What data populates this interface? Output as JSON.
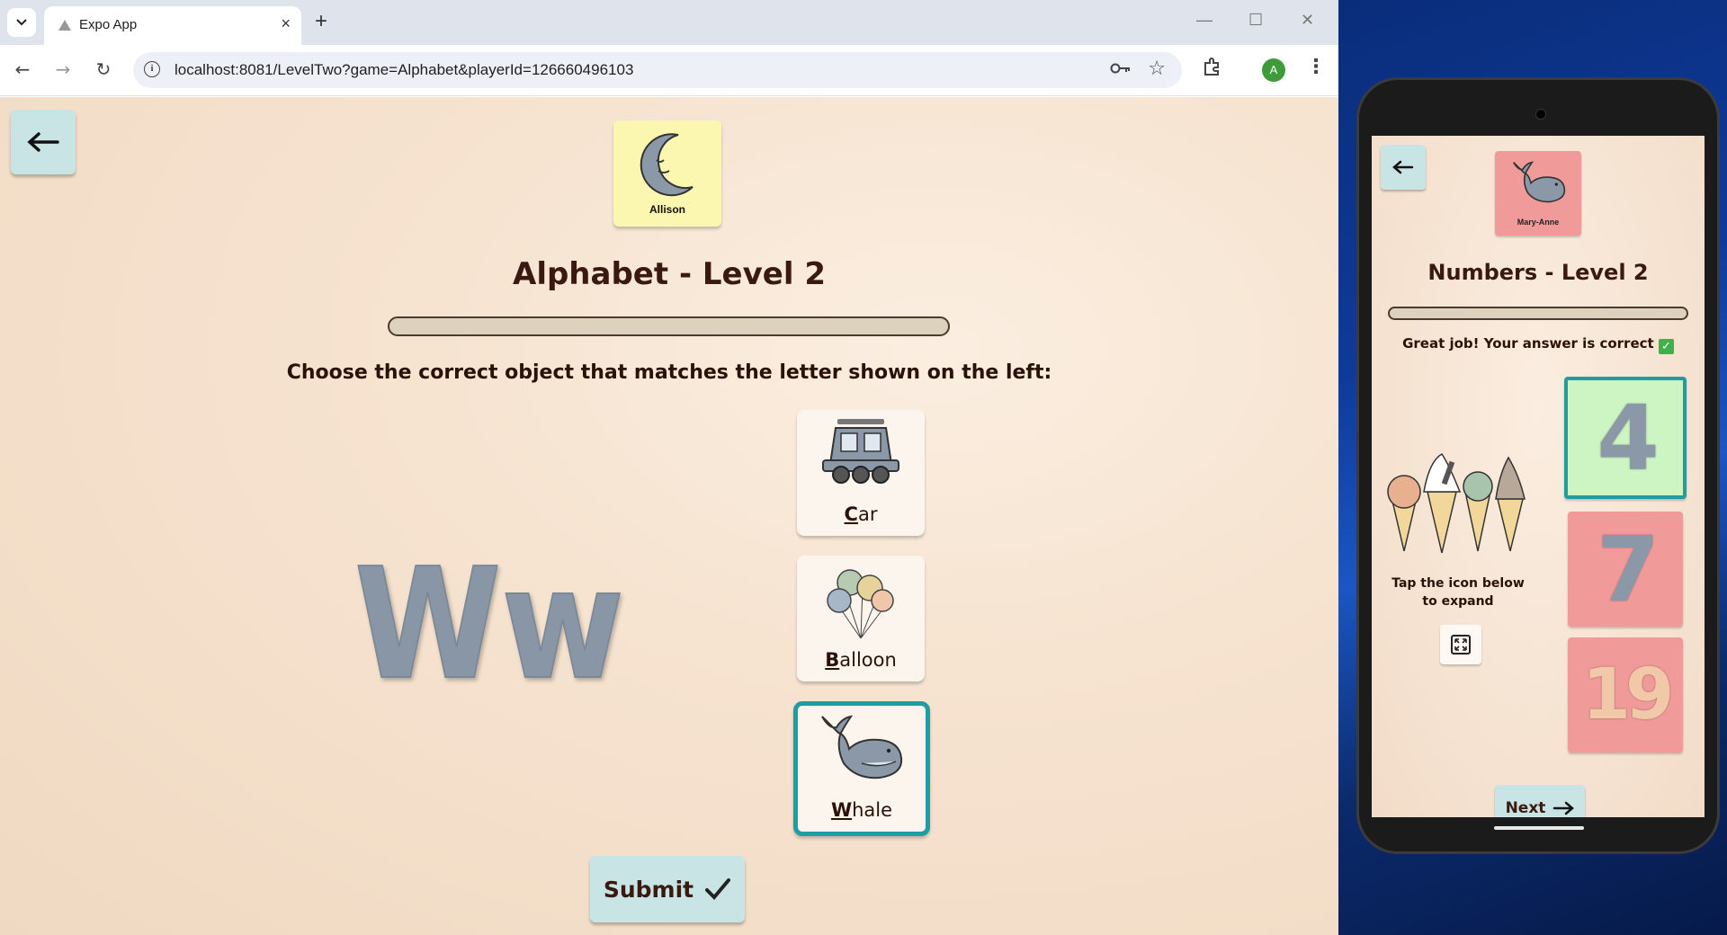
{
  "browser": {
    "tab_title": "Expo App",
    "tab_close": "×",
    "new_tab": "+",
    "url": "localhost:8081/LevelTwo?game=Alphabet&playerId=126660496103",
    "profile_initial": "A",
    "window_controls": [
      "—",
      "☐",
      "✕"
    ]
  },
  "game": {
    "player_name": "Allison",
    "avatar_icon": "moon-icon",
    "title": "Alphabet - Level 2",
    "progress": 0,
    "instructions": "Choose the correct object that matches the letter shown on the left:",
    "letter": "Ww",
    "options": [
      {
        "first": "C",
        "rest": "ar",
        "icon": "car-icon",
        "selected": false
      },
      {
        "first": "B",
        "rest": "alloon",
        "icon": "balloon-icon",
        "selected": false
      },
      {
        "first": "W",
        "rest": "hale",
        "icon": "whale-icon",
        "selected": true
      }
    ],
    "submit_label": "Submit"
  },
  "phone": {
    "player_name": "Mary-Anne",
    "avatar_icon": "whale-icon",
    "title": "Numbers - Level 2",
    "progress": 0,
    "feedback": "Great job! Your answer is correct",
    "feedback_icon": "✓",
    "tap_text": "Tap the icon below to expand",
    "numbers": [
      {
        "value": "4",
        "bg": "#cdf5c4",
        "fg": "#8a98a8",
        "selected": true
      },
      {
        "value": "7",
        "bg": "#f19a9a",
        "fg": "#8a98a8",
        "selected": false
      },
      {
        "value": "19",
        "bg": "#f19a9a",
        "fg": "#f1c9a8",
        "selected": false
      }
    ],
    "next_label": "Next"
  },
  "colors": {
    "accent_teal": "#1f9da3",
    "button_bg": "#c9e4e4",
    "title_brown": "#3a1a10"
  }
}
